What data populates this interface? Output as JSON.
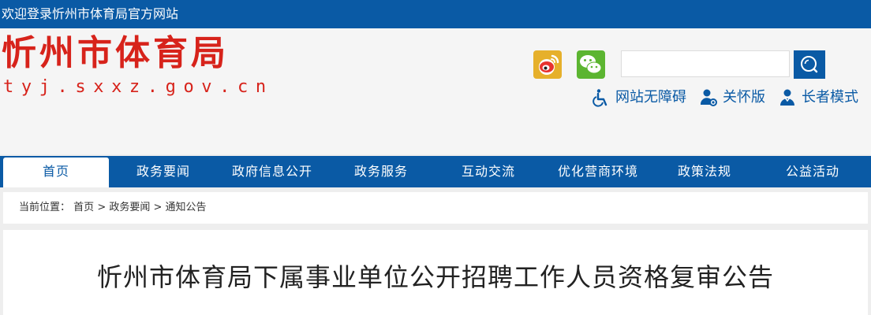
{
  "topbar": {
    "welcome": "欢迎登录忻州市体育局官方网站"
  },
  "header": {
    "logo_title": "忻州市体育局",
    "logo_url": "tyj.sxxz.gov.cn",
    "social": [
      {
        "name": "weibo-icon",
        "color": "#e6b02b"
      },
      {
        "name": "wechat-icon",
        "color": "#5cb531"
      }
    ],
    "search": {
      "placeholder": "",
      "value": ""
    },
    "accessibility": {
      "barrier_free": "网站无障碍",
      "care_version": "关怀版",
      "elder_mode": "长者模式"
    }
  },
  "nav": {
    "items": [
      {
        "label": "首页",
        "active": true
      },
      {
        "label": "政务要闻",
        "active": false
      },
      {
        "label": "政府信息公开",
        "active": false
      },
      {
        "label": "政务服务",
        "active": false
      },
      {
        "label": "互动交流",
        "active": false
      },
      {
        "label": "优化营商环境",
        "active": false
      },
      {
        "label": "政策法规",
        "active": false
      },
      {
        "label": "公益活动",
        "active": false
      }
    ]
  },
  "breadcrumb": {
    "prefix": "当前位置：",
    "items": [
      "首页",
      "政务要闻",
      "通知公告"
    ],
    "separator": " > "
  },
  "article": {
    "title": "忻州市体育局下属事业单位公开招聘工作人员资格复审公告"
  },
  "colors": {
    "brand_blue": "#0a5aa5",
    "logo_red": "#d7231b"
  }
}
